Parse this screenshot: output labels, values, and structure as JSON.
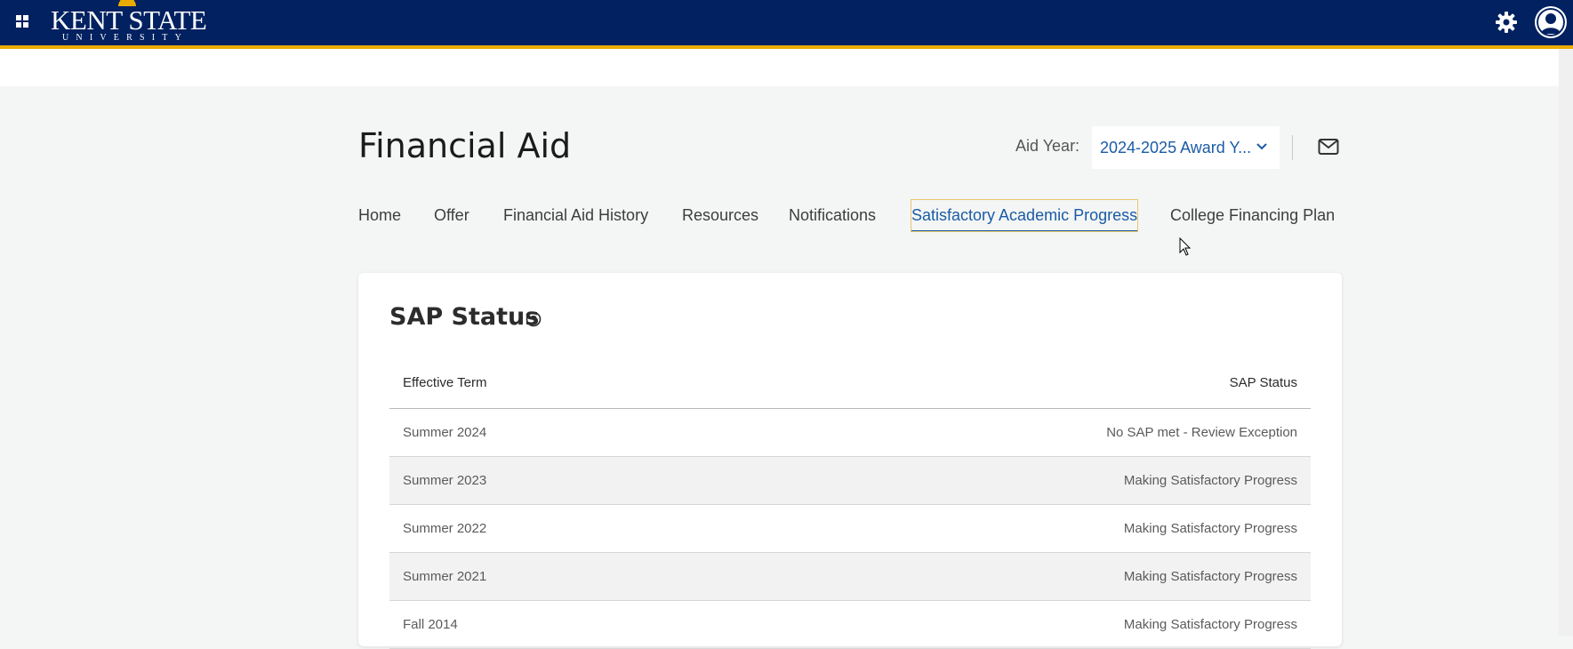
{
  "header": {
    "logo_text": "KENT STATE",
    "logo_subtext": "UNIVERSITY",
    "brand_color": "#012161",
    "accent_color": "#eaab00",
    "icons": [
      "apps-grid-icon",
      "gear-icon",
      "user-avatar-icon"
    ]
  },
  "page": {
    "title": "Financial Aid",
    "aid_year_label": "Aid Year:",
    "aid_year_value": "2024-2025 Award Y...",
    "mail_icon": "envelope-icon"
  },
  "tabs": [
    {
      "label": "Home",
      "active": false
    },
    {
      "label": "Offer",
      "active": false
    },
    {
      "label": "Financial Aid History",
      "active": false
    },
    {
      "label": "Resources",
      "active": false
    },
    {
      "label": "Notifications",
      "active": false
    },
    {
      "label": "Satisfactory Academic Progress",
      "active": true
    },
    {
      "label": "College Financing Plan",
      "active": false
    }
  ],
  "sap": {
    "title": "SAP Status",
    "columns": [
      "Effective Term",
      "SAP Status"
    ],
    "rows": [
      {
        "term": "Summer 2024",
        "status": "No SAP met - Review Exception"
      },
      {
        "term": "Summer 2023",
        "status": "Making Satisfactory Progress"
      },
      {
        "term": "Summer 2022",
        "status": "Making Satisfactory Progress"
      },
      {
        "term": "Summer 2021",
        "status": "Making Satisfactory Progress"
      },
      {
        "term": "Fall 2014",
        "status": "Making Satisfactory Progress"
      }
    ]
  }
}
